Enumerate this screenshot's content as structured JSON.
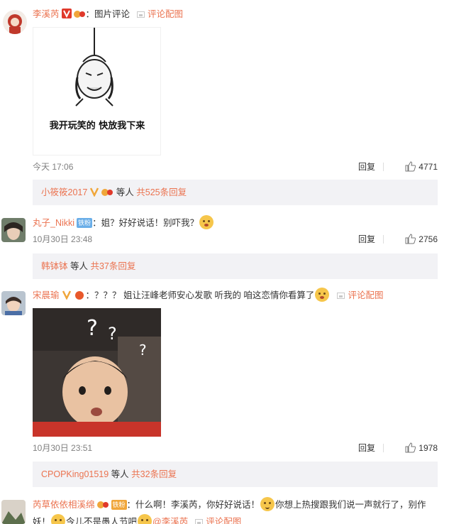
{
  "comments": [
    {
      "username": "李溪芮",
      "text": "：图片评论",
      "pic_link": "评论配图",
      "meme_caption": "我开玩笑的  快放我下来",
      "time": "今天 17:06",
      "reply_label": "回复",
      "likes": "4771",
      "replies": {
        "first_user": "小筱筱2017",
        "suffix": " 等人",
        "more": "共525条回复"
      }
    },
    {
      "username": "丸子_Nikki",
      "fan_tag": "铁粉",
      "text": "：姐？好好说话！别吓我？",
      "time": "10月30日 23:48",
      "reply_label": "回复",
      "likes": "2756",
      "replies": {
        "first_user": "韩钵钵",
        "suffix": " 等人",
        "more": "共37条回复"
      }
    },
    {
      "username": "宋晨瑜",
      "text": "：？？？ 姐让汪峰老师安心发歌 听我的 咱这恋情你看算了",
      "pic_link": "评论配图",
      "time": "10月30日 23:51",
      "reply_label": "回复",
      "likes": "1978",
      "replies": {
        "first_user": "CPOPKing01519",
        "suffix": " 等人",
        "more": "共32条回复"
      }
    },
    {
      "username": "芮草依依相溪绵",
      "fan_tag": "铁粉",
      "text_a": "：什么啊！李溪芮，你好好说话！",
      "text_b": "你想上热搜跟我们说一声就行了，别作妖！",
      "text_c": "今儿不是愚人节吧",
      "mention": "@李溪芮",
      "pic_link": "评论配图"
    }
  ],
  "colors": {
    "link": "#eb7350",
    "text": "#333333",
    "meta": "#808080",
    "reply_box": "#f2f2f5"
  },
  "icons": [
    "verified-v-icon",
    "medal-icon",
    "pic-icon",
    "like-thumb-icon",
    "emoji-icon"
  ]
}
